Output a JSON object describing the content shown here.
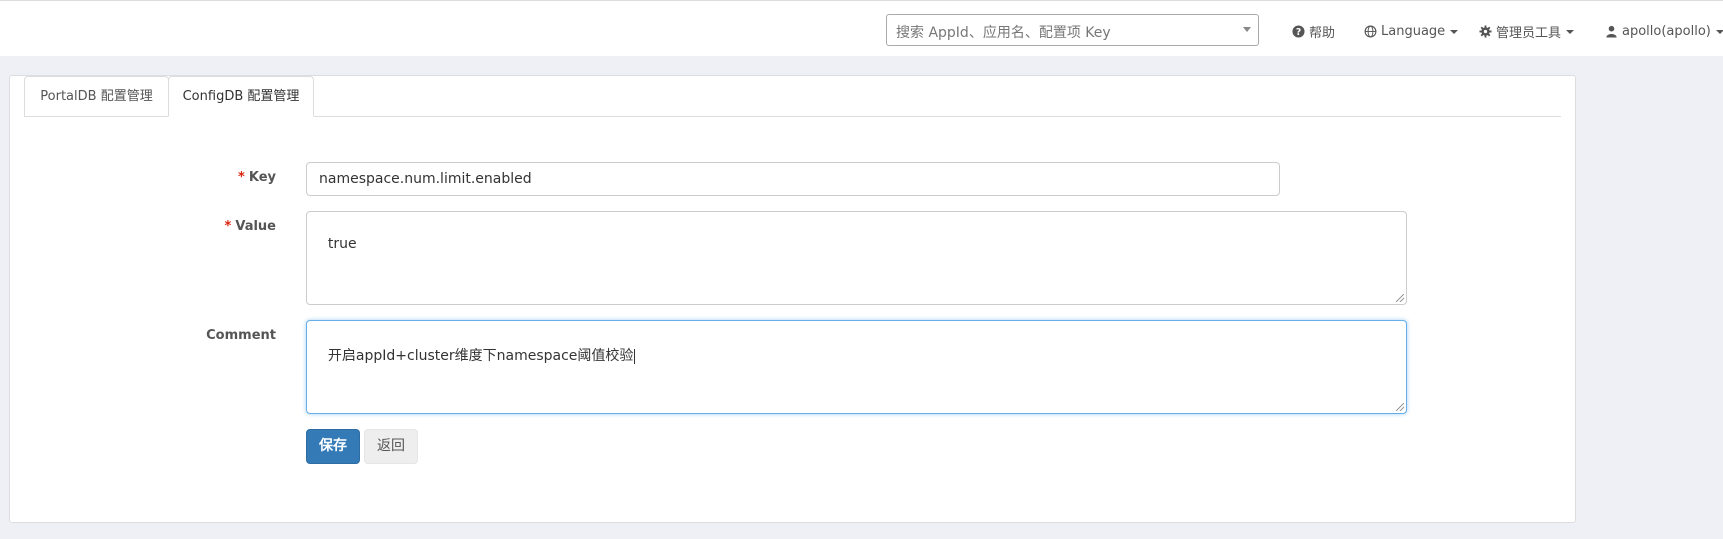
{
  "topbar": {
    "search_placeholder": "搜索 AppId、应用名、配置项 Key",
    "help_label": "帮助",
    "language_label": "Language",
    "admin_tools_label": "管理员工具",
    "user_label": "apollo(apollo)"
  },
  "tabs": [
    {
      "label": "PortalDB 配置管理",
      "active": false
    },
    {
      "label": "ConfigDB 配置管理",
      "active": true
    }
  ],
  "form": {
    "key_label": "Key",
    "key_value": "namespace.num.limit.enabled",
    "value_label": "Value",
    "value_value": "true",
    "comment_label": "Comment",
    "comment_value": "开启appId+cluster维度下namespace阈值校验",
    "required_mark": "*",
    "save_label": "保存",
    "back_label": "返回"
  },
  "colors": {
    "primary": "#337ab7",
    "required": "#d9230f",
    "background": "#eff0f5"
  }
}
